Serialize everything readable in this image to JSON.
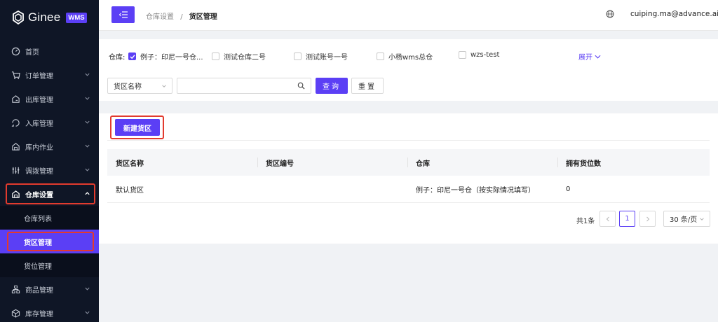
{
  "brand": {
    "name": "Ginee",
    "badge": "WMS"
  },
  "header": {
    "breadcrumb": [
      "仓库设置",
      "货区管理"
    ],
    "separator": "/",
    "user_email": "cuiping.ma@advance.ai"
  },
  "sidebar": {
    "items": [
      {
        "label": "首页",
        "icon": "dashboard-icon"
      },
      {
        "label": "订单管理",
        "icon": "cart-icon"
      },
      {
        "label": "出库管理",
        "icon": "outbound-icon"
      },
      {
        "label": "入库管理",
        "icon": "inbound-icon"
      },
      {
        "label": "库内作业",
        "icon": "warehouse-ops-icon"
      },
      {
        "label": "调拨管理",
        "icon": "transfer-icon"
      },
      {
        "label": "仓库设置",
        "icon": "warehouse-settings-icon"
      },
      {
        "label": "商品管理",
        "icon": "product-icon"
      },
      {
        "label": "库存管理",
        "icon": "inventory-icon"
      }
    ],
    "sub_items": [
      "仓库列表",
      "货区管理",
      "货位管理"
    ]
  },
  "filter": {
    "warehouse_label": "仓库:",
    "warehouses": [
      {
        "label": "例子：印尼一号仓...",
        "checked": true
      },
      {
        "label": "测试仓库二号",
        "checked": false
      },
      {
        "label": "测试账号一号",
        "checked": false
      },
      {
        "label": "小杨wms总仓",
        "checked": false
      },
      {
        "label": "wzs-test",
        "checked": false
      }
    ],
    "expand_label": "展开",
    "search_field_select": "货区名称",
    "search_value": "",
    "query_label": "查询",
    "reset_label": "重置"
  },
  "main": {
    "new_button_label": "新建货区",
    "columns": [
      "货区名称",
      "货区编号",
      "仓库",
      "拥有货位数"
    ],
    "rows": [
      [
        "默认货区",
        "",
        "例子：印尼一号仓（按实际情况填写）",
        "0"
      ]
    ],
    "pagination": {
      "total_text": "共1条",
      "current_page": "1",
      "page_size": "30 条/页"
    }
  },
  "colors": {
    "accent": "#5b3ff5",
    "sidebar_bg": "#0f1626",
    "highlight_border": "#e23b2e"
  }
}
